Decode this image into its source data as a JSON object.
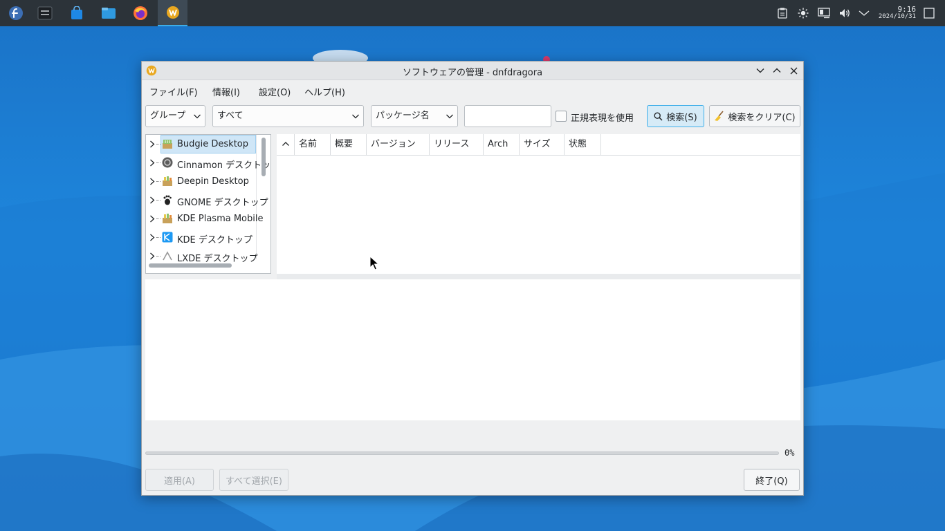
{
  "taskbar": {
    "apps": [
      {
        "name": "Fedora",
        "icon": "fedora-logo-icon",
        "color": "#3c6eb4"
      },
      {
        "name": "System settings",
        "icon": "settings-panel-icon",
        "color": "#23282d"
      },
      {
        "name": "Software store",
        "icon": "store-bag-icon",
        "color": "#1e88e5"
      },
      {
        "name": "File manager",
        "icon": "folder-icon",
        "color": "#2f9ae0"
      },
      {
        "name": "Firefox",
        "icon": "firefox-icon",
        "color": "#ff7139"
      },
      {
        "name": "dnfdragora",
        "icon": "dnfdragora-icon",
        "color": "#e9a820"
      }
    ],
    "tray_icons": [
      "clipboard-icon",
      "brightness-icon",
      "network-icon",
      "volume-icon",
      "chevron-down-icon"
    ],
    "clock_time": "9:16",
    "clock_date": "2024/10/31",
    "show_desktop_icon": "show-desktop-icon"
  },
  "window": {
    "title": "ソフトウェアの管理 - dnfdragora",
    "menus": [
      "ファイル(F)",
      "情報(I)",
      "設定(O)",
      "ヘルプ(H)"
    ],
    "filter": {
      "view_combo": "グループ",
      "status_combo": "すべて",
      "search_field_combo": "パッケージ名",
      "search_text": "",
      "regex_label": "正規表現を使用",
      "regex_checked": false,
      "search_button": "検索(S)",
      "clear_button": "検索をクリア(C)"
    },
    "groups": [
      {
        "label": "Budgie Desktop",
        "icon": "budgie-icon",
        "selected": true
      },
      {
        "label": "Cinnamon デスクトップ",
        "icon": "cinnamon-icon",
        "selected": false
      },
      {
        "label": "Deepin Desktop",
        "icon": "package-icon",
        "selected": false
      },
      {
        "label": "GNOME デスクトップ",
        "icon": "gnome-foot-icon",
        "selected": false
      },
      {
        "label": "KDE Plasma Mobile",
        "icon": "package-icon",
        "selected": false
      },
      {
        "label": "KDE デスクトップ",
        "icon": "kde-icon",
        "selected": false
      },
      {
        "label": "LXDE デスクトップ",
        "icon": "lxde-icon",
        "selected": false
      }
    ],
    "table_columns": [
      "名前",
      "概要",
      "バージョン",
      "リリース",
      "Arch",
      "サイズ",
      "状態"
    ],
    "progress": {
      "value": 0,
      "label": "0%"
    },
    "buttons": {
      "apply": "適用(A)",
      "select_all": "すべて選択(E)",
      "quit": "終了(Q)"
    }
  },
  "colors": {
    "accent": "#3daee9",
    "desktop": "#1e86dc",
    "taskbar": "#2c3339"
  }
}
